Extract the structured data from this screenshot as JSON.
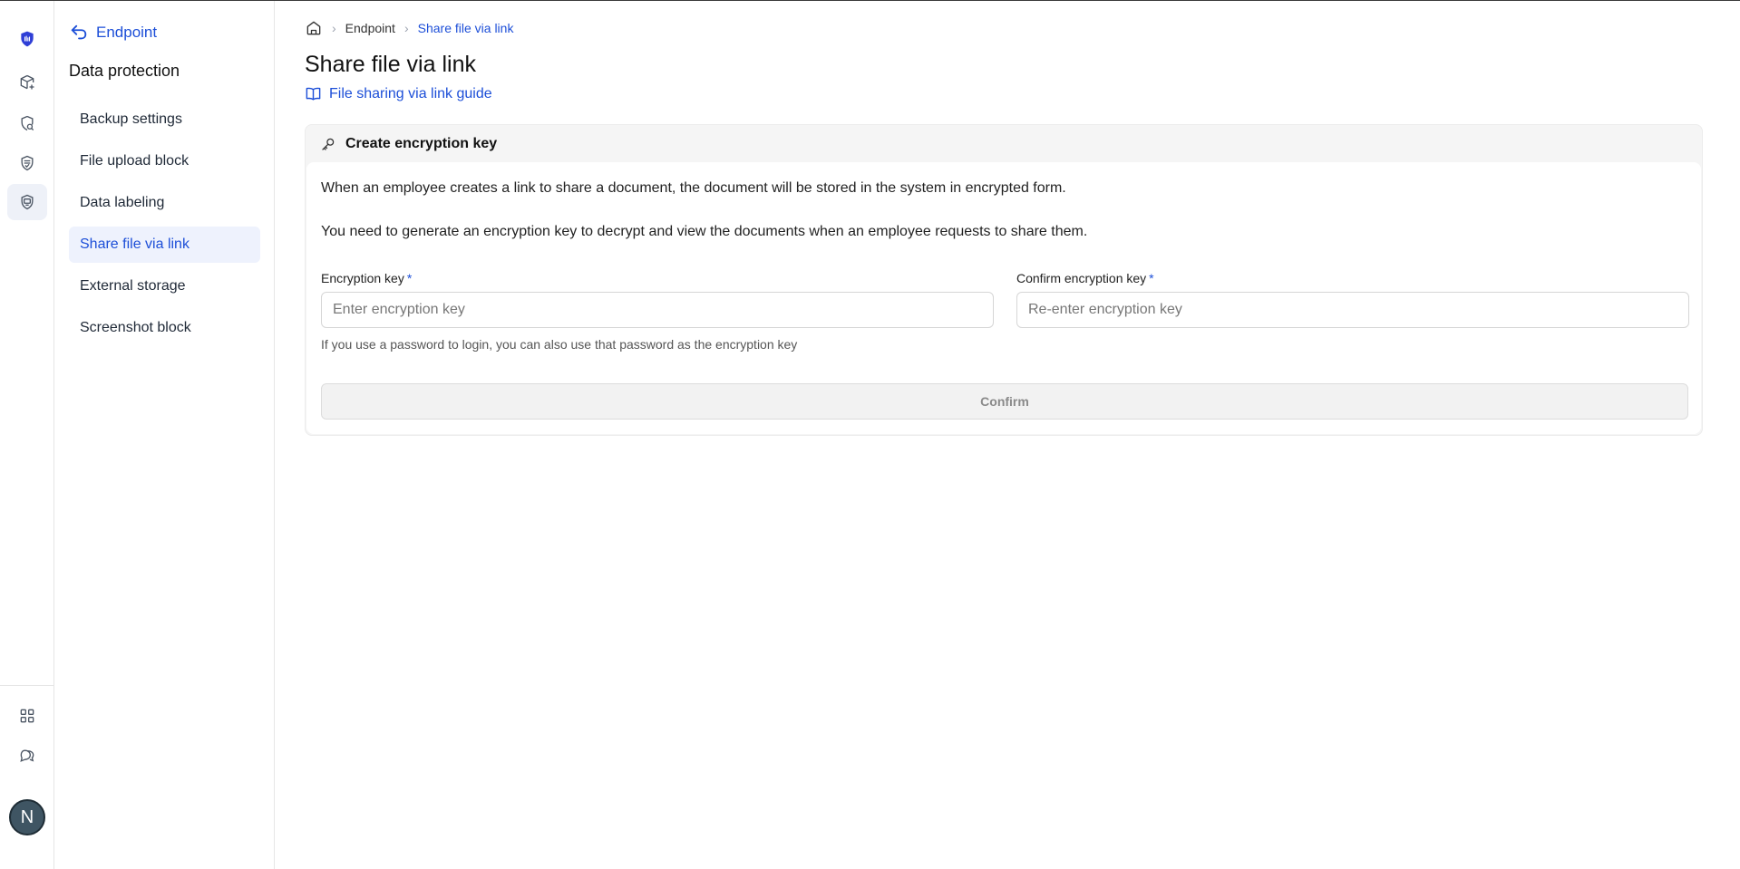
{
  "rail": {
    "items": [
      {
        "icon": "shield-logo-icon"
      },
      {
        "icon": "box-plus-icon"
      },
      {
        "icon": "search-shield-icon"
      },
      {
        "icon": "shield-check-icon"
      },
      {
        "icon": "shield-monitor-icon"
      }
    ],
    "bottom": [
      {
        "icon": "grid-icon"
      },
      {
        "icon": "chat-icon"
      }
    ],
    "avatar_initial": "N"
  },
  "sidebar": {
    "back_label": "Endpoint",
    "title": "Data protection",
    "items": [
      {
        "label": "Backup settings"
      },
      {
        "label": "File upload block"
      },
      {
        "label": "Data labeling"
      },
      {
        "label": "Share file via link"
      },
      {
        "label": "External storage"
      },
      {
        "label": "Screenshot block"
      }
    ],
    "active_index": 3
  },
  "breadcrumb": {
    "items": [
      "Endpoint",
      "Share file via link"
    ]
  },
  "page": {
    "title": "Share file via link",
    "guide_link": "File sharing via link guide"
  },
  "card": {
    "title": "Create encryption key",
    "paragraph1": "When an employee creates a link to share a document, the document will be stored in the system in encrypted form.",
    "paragraph2": "You need to generate an encryption key to decrypt and view the documents when an employee requests to share them.",
    "field1": {
      "label": "Encryption key",
      "required": "*",
      "placeholder": "Enter encryption key",
      "value": ""
    },
    "field2": {
      "label": "Confirm encryption key",
      "required": "*",
      "placeholder": "Re-enter encryption key",
      "value": ""
    },
    "hint": "If you use a password to login, you can also use that password as the encryption key",
    "confirm_label": "Confirm"
  },
  "colors": {
    "accent": "#1d4fd8",
    "active_bg": "#eef2fd",
    "rail_active_bg": "#eef1f8",
    "avatar_bg": "#3f5563"
  }
}
